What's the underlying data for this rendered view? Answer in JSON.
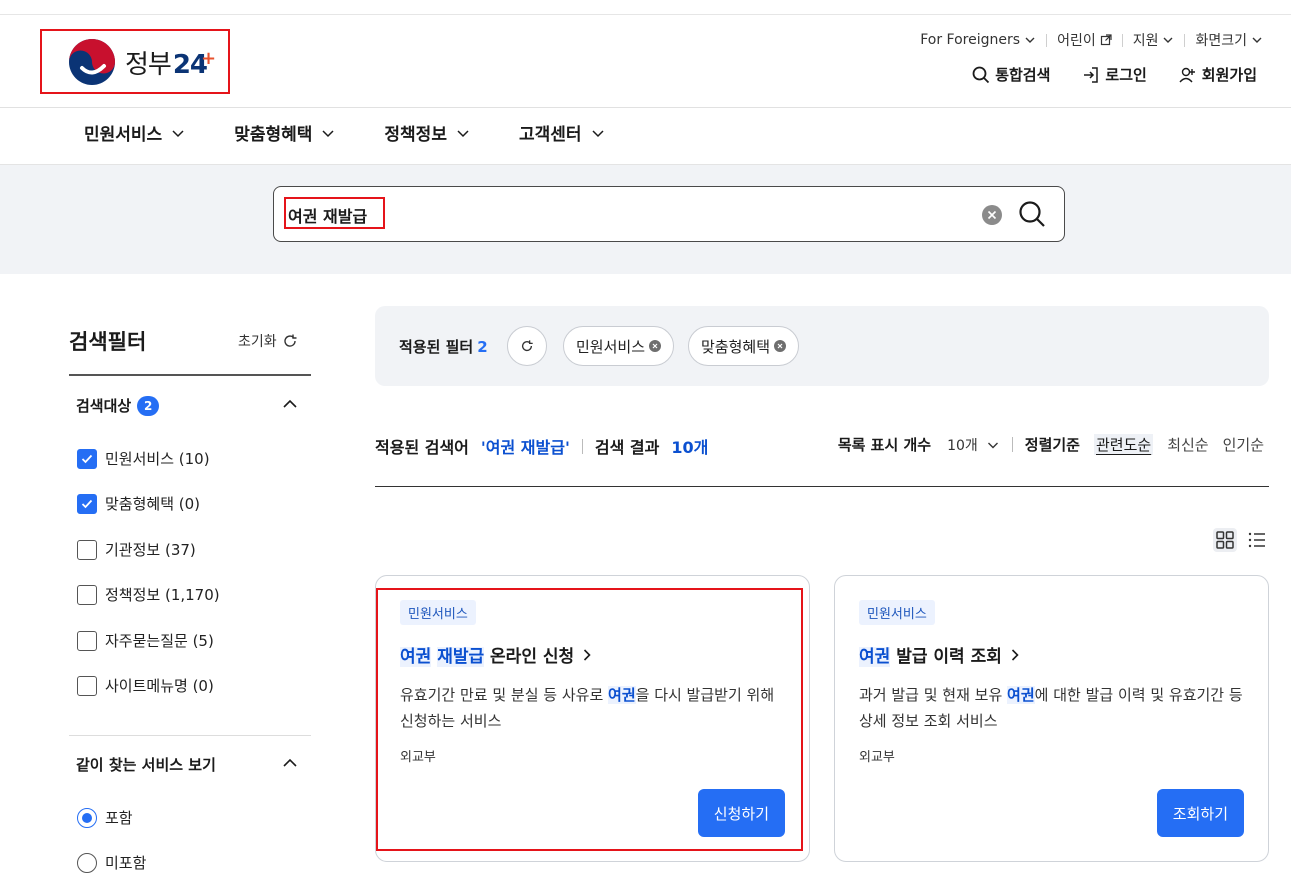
{
  "header": {
    "logo_text": "정부",
    "logo_num": "24",
    "logo_plus": "+",
    "util": [
      {
        "label": "For Foreigners",
        "icon": "chevron-down-icon"
      },
      {
        "label": "어린이",
        "icon": "external-link-icon"
      },
      {
        "label": "지원",
        "icon": "chevron-down-icon"
      },
      {
        "label": "화면크기",
        "icon": "chevron-down-icon"
      }
    ],
    "account": [
      {
        "label": "통합검색",
        "icon": "search-icon"
      },
      {
        "label": "로그인",
        "icon": "login-icon"
      },
      {
        "label": "회원가입",
        "icon": "user-plus-icon"
      }
    ]
  },
  "gnb": [
    "민원서비스",
    "맞춤형혜택",
    "정책정보",
    "고객센터"
  ],
  "search": {
    "query": "여권 재발급"
  },
  "filter": {
    "title": "검색필터",
    "reset": "초기화",
    "target_label": "검색대상",
    "target_count": "2",
    "options": [
      {
        "label": "민원서비스 (10)",
        "checked": true
      },
      {
        "label": "맞춤형혜택 (0)",
        "checked": true
      },
      {
        "label": "기관정보 (37)",
        "checked": false
      },
      {
        "label": "정책정보 (1,170)",
        "checked": false
      },
      {
        "label": "자주묻는질문 (5)",
        "checked": false
      },
      {
        "label": "사이트메뉴명 (0)",
        "checked": false
      }
    ],
    "related_label": "같이 찾는 서비스 보기",
    "radios": [
      {
        "label": "포함",
        "selected": true
      },
      {
        "label": "미포함",
        "selected": false
      }
    ]
  },
  "applied": {
    "label": "적용된 필터",
    "count": "2",
    "chips": [
      "민원서비스",
      "맞춤형혜택"
    ]
  },
  "results": {
    "applied_kw_label": "적용된 검색어",
    "keyword": "'여권 재발급'",
    "result_label": "검색 결과",
    "count": "10개",
    "list_count_label": "목록 표시 개수",
    "list_count_value": "10개",
    "sort_label": "정렬기준",
    "sort_options": [
      "관련도순",
      "최신순",
      "인기순"
    ],
    "active_sort": "관련도순"
  },
  "cards": [
    {
      "tag": "민원서비스",
      "title_parts": [
        {
          "t": "여권",
          "hl": true
        },
        {
          "t": " ",
          "hl": false
        },
        {
          "t": "재발급",
          "hl": true
        },
        {
          "t": " 온라인 신청",
          "hl": false
        }
      ],
      "desc_parts": [
        {
          "t": "유효기간 만료 및 분실 등 사유로 ",
          "hl": false
        },
        {
          "t": "여권",
          "hl": true
        },
        {
          "t": "을 다시 발급받기 위해 신청하는 서비스",
          "hl": false
        }
      ],
      "org": "외교부",
      "button": "신청하기"
    },
    {
      "tag": "민원서비스",
      "title_parts": [
        {
          "t": "여권",
          "hl": true
        },
        {
          "t": " 발급 이력 조회",
          "hl": false
        }
      ],
      "desc_parts": [
        {
          "t": "과거 발급 및 현재 보유 ",
          "hl": false
        },
        {
          "t": "여권",
          "hl": true
        },
        {
          "t": "에 대한 발급 이력 및 유효기간 등 상세 정보 조회 서비스",
          "hl": false
        }
      ],
      "org": "외교부",
      "button": "조회하기"
    }
  ],
  "colors": {
    "accent": "#256ef4",
    "highlight_box": "#e5141a",
    "logo_red": "#c8102e",
    "logo_blue": "#0b3475",
    "band_bg": "#f1f3f6"
  }
}
